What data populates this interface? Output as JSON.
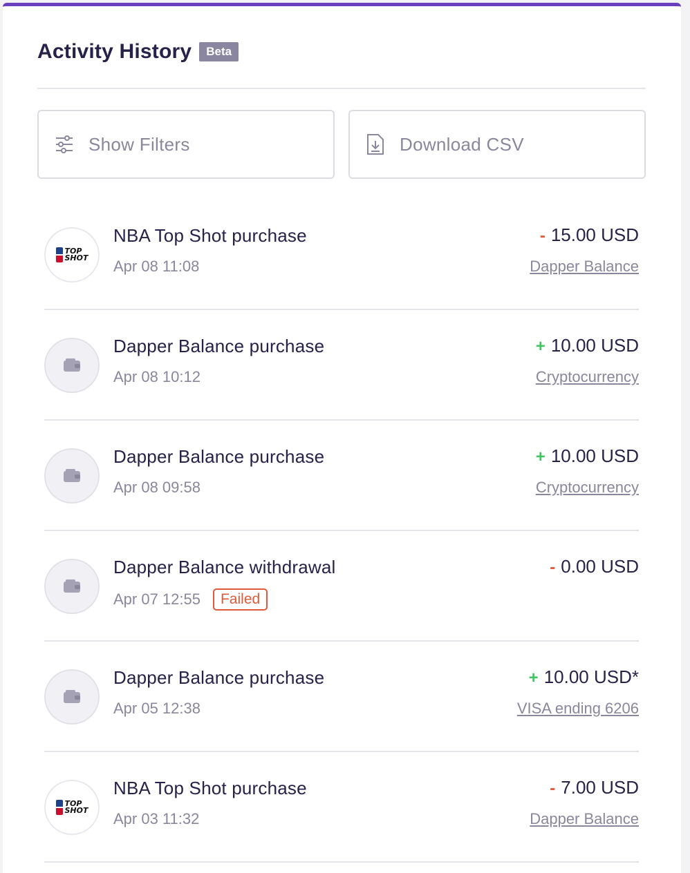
{
  "header": {
    "title": "Activity History",
    "badge": "Beta"
  },
  "toolbar": {
    "filters_label": "Show Filters",
    "csv_label": "Download CSV"
  },
  "colors": {
    "accent": "#6a3fbf",
    "negative": "#e05a3a",
    "positive": "#43c463",
    "text": "#26224a",
    "muted": "#8a879c"
  },
  "transactions": [
    {
      "icon": "top-shot-logo",
      "name": "NBA Top Shot purchase",
      "date": "Apr 08 11:08",
      "sign": "-",
      "amount": "15.00 USD",
      "method": "Dapper Balance"
    },
    {
      "icon": "wallet-icon",
      "name": "Dapper Balance purchase",
      "date": "Apr 08 10:12",
      "sign": "+",
      "amount": "10.00 USD",
      "method": "Cryptocurrency"
    },
    {
      "icon": "wallet-icon",
      "name": "Dapper Balance purchase",
      "date": "Apr 08 09:58",
      "sign": "+",
      "amount": "10.00 USD",
      "method": "Cryptocurrency"
    },
    {
      "icon": "wallet-icon",
      "name": "Dapper Balance withdrawal",
      "date": "Apr 07 12:55",
      "status": "Failed",
      "sign": "-",
      "amount": "0.00 USD",
      "method": ""
    },
    {
      "icon": "wallet-icon",
      "name": "Dapper Balance purchase",
      "date": "Apr 05 12:38",
      "sign": "+",
      "amount": "10.00 USD*",
      "method": "VISA ending 6206"
    },
    {
      "icon": "top-shot-logo",
      "name": "NBA Top Shot purchase",
      "date": "Apr 03 11:32",
      "sign": "-",
      "amount": "7.00 USD",
      "method": "Dapper Balance"
    }
  ],
  "logo_text": {
    "line1": "TOP",
    "line2": "SHOT"
  }
}
